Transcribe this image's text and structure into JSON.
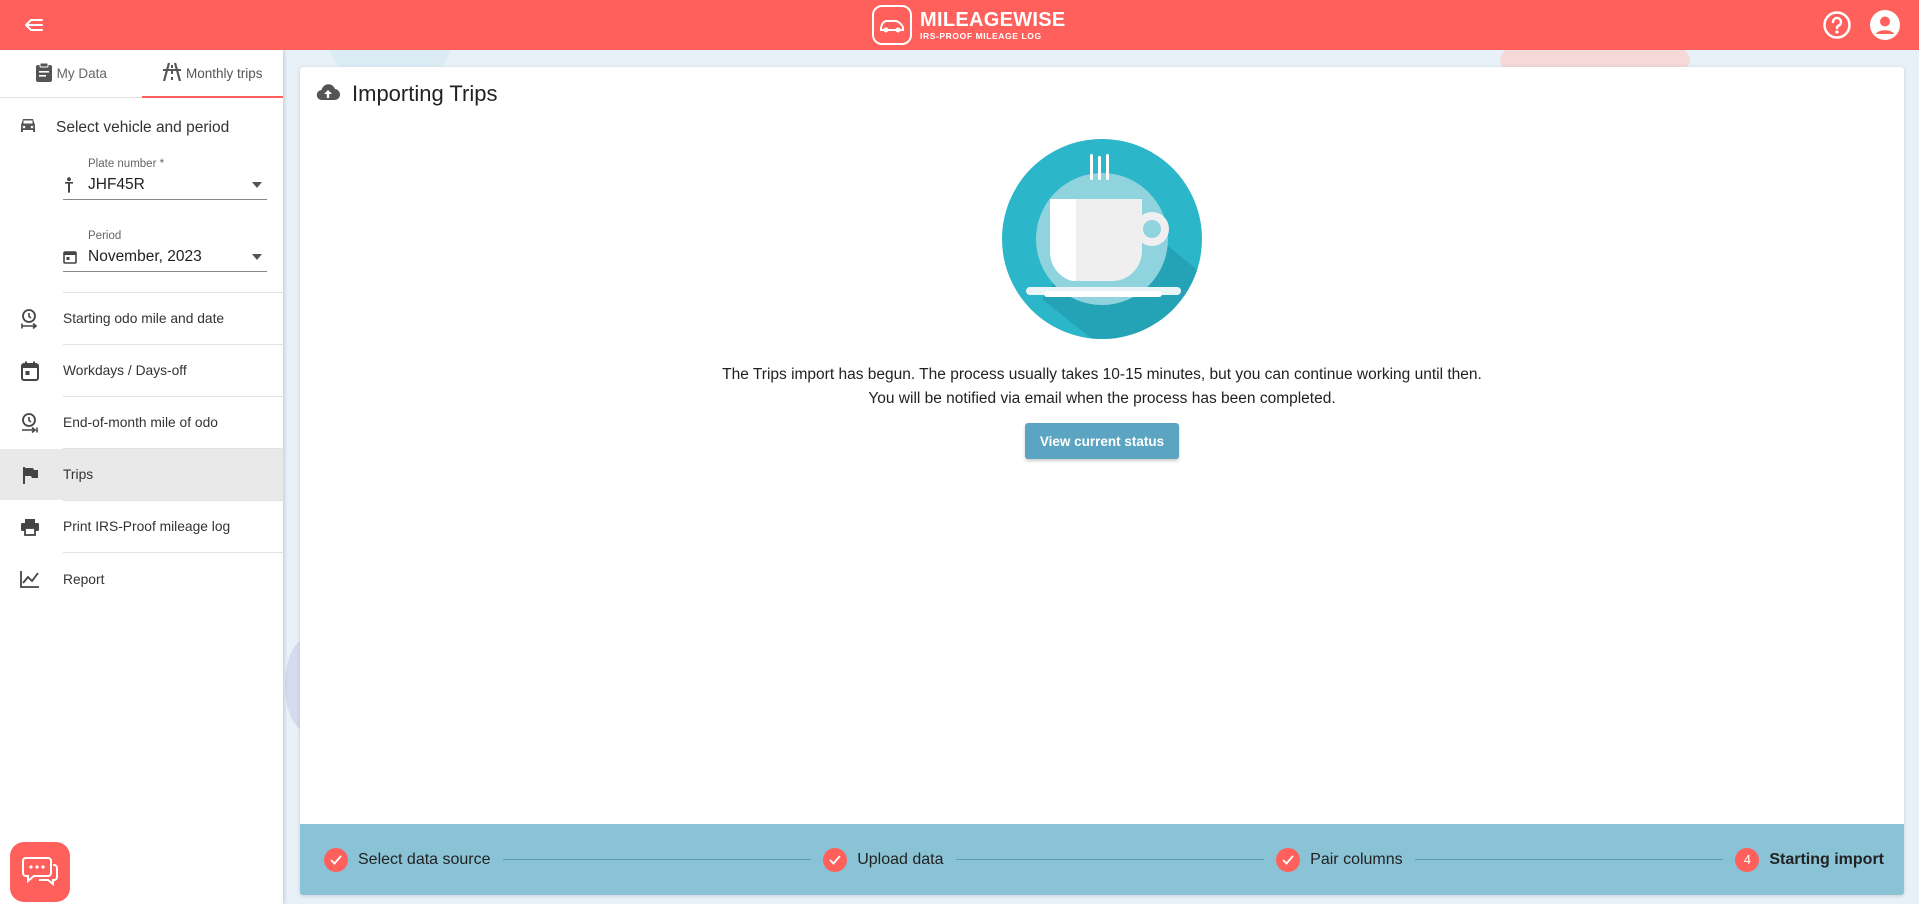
{
  "topbar": {
    "brand": "MILEAGEWISE",
    "tagline": "IRS-PROOF MILEAGE LOG",
    "icons": [
      "back-arrow-icon",
      "help-icon",
      "account-icon"
    ],
    "color": "#ff605c"
  },
  "sidebar": {
    "tabs": [
      {
        "label": "My Data",
        "icon": "clipboard-icon"
      },
      {
        "label": "Monthly trips",
        "icon": "road-icon",
        "active": true
      }
    ],
    "section_title": "Select vehicle and period",
    "plate": {
      "label": "Plate number *",
      "value": "JHF45R"
    },
    "period": {
      "label": "Period",
      "value": "November, 2023"
    },
    "menu": [
      {
        "label": "Starting odo mile and date",
        "icon": "odometer-start-icon"
      },
      {
        "label": "Workdays / Days-off",
        "icon": "calendar-icon"
      },
      {
        "label": "End-of-month mile of odo",
        "icon": "odometer-end-icon"
      },
      {
        "label": "Trips",
        "icon": "flag-icon",
        "active": true
      },
      {
        "label": "Print IRS-Proof mileage log",
        "icon": "printer-icon"
      },
      {
        "label": "Report",
        "icon": "chart-line-icon"
      }
    ]
  },
  "main": {
    "title": "Importing Trips",
    "message_line1": "The Trips import has begun. The process usually takes 10-15 minutes, but you can continue working until then.",
    "message_line2": "You will be notified via email when the process has been completed.",
    "status_button": "View current status",
    "steps": [
      {
        "label": "Select data source",
        "state": "done"
      },
      {
        "label": "Upload data",
        "state": "done"
      },
      {
        "label": "Pair columns",
        "state": "done"
      },
      {
        "label": "Starting import",
        "state": "current",
        "number": "4"
      }
    ]
  },
  "colors": {
    "accent": "#ff605c",
    "stepper": "#8ac3d6",
    "button": "#5ba5c2"
  }
}
